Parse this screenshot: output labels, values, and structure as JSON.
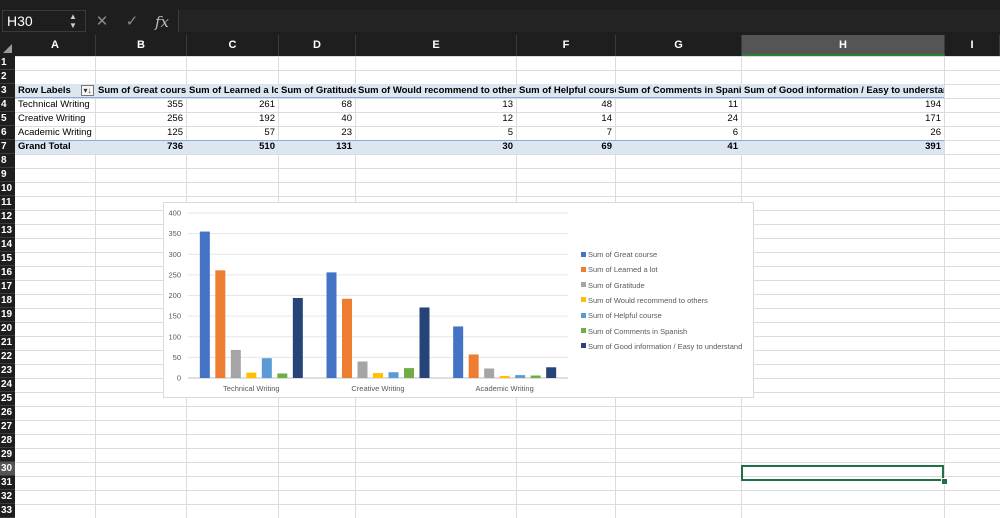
{
  "formula_bar": {
    "name_box": "H30",
    "fx": "fx",
    "cancel": "✕",
    "enter": "✓",
    "value": ""
  },
  "columns": [
    "A",
    "B",
    "C",
    "D",
    "E",
    "F",
    "G",
    "H",
    "I"
  ],
  "selected_column": "H",
  "rows": [
    "1",
    "2",
    "3",
    "4",
    "5",
    "6",
    "7",
    "8",
    "9",
    "10",
    "11",
    "12",
    "13",
    "14",
    "15",
    "16",
    "17",
    "18",
    "19",
    "20",
    "21",
    "22",
    "23",
    "24",
    "25",
    "26",
    "27",
    "28",
    "29",
    "30",
    "31",
    "32",
    "33"
  ],
  "selected_row": "30",
  "pivot": {
    "headers": [
      "Row Labels",
      "Sum of Great course",
      "Sum of Learned a lot",
      "Sum of Gratitude",
      "Sum of Would recommend to others",
      "Sum of Helpful course",
      "Sum of Comments in Spanish",
      "Sum of Good information / Easy to understand"
    ],
    "rows": [
      {
        "label": "Technical Writing",
        "values": [
          "355",
          "261",
          "68",
          "13",
          "48",
          "11",
          "194"
        ]
      },
      {
        "label": "Creative Writing",
        "values": [
          "256",
          "192",
          "40",
          "12",
          "14",
          "24",
          "171"
        ]
      },
      {
        "label": "Academic Writing",
        "values": [
          "125",
          "57",
          "23",
          "5",
          "7",
          "6",
          "26"
        ]
      }
    ],
    "total": {
      "label": "Grand Total",
      "values": [
        "736",
        "510",
        "131",
        "30",
        "69",
        "41",
        "391"
      ]
    }
  },
  "chart_data": {
    "type": "bar",
    "categories": [
      "Technical Writing",
      "Creative Writing",
      "Academic Writing"
    ],
    "series": [
      {
        "name": "Sum of Great course",
        "values": [
          355,
          256,
          125
        ],
        "color": "#4472c4"
      },
      {
        "name": "Sum of Learned a lot",
        "values": [
          261,
          192,
          57
        ],
        "color": "#ed7d31"
      },
      {
        "name": "Sum of Gratitude",
        "values": [
          68,
          40,
          23
        ],
        "color": "#a5a5a5"
      },
      {
        "name": "Sum of Would recommend to others",
        "values": [
          13,
          12,
          5
        ],
        "color": "#ffc000"
      },
      {
        "name": "Sum of Helpful course",
        "values": [
          48,
          14,
          7
        ],
        "color": "#5b9bd5"
      },
      {
        "name": "Sum of Comments in Spanish",
        "values": [
          11,
          24,
          6
        ],
        "color": "#70ad47"
      },
      {
        "name": "Sum of Good information / Easy to understand",
        "values": [
          194,
          171,
          26
        ],
        "color": "#264478"
      }
    ],
    "yticks": [
      "0",
      "50",
      "100",
      "150",
      "200",
      "250",
      "300",
      "350",
      "400"
    ],
    "ylim": [
      0,
      400
    ],
    "grid": true,
    "legend_position": "right"
  }
}
